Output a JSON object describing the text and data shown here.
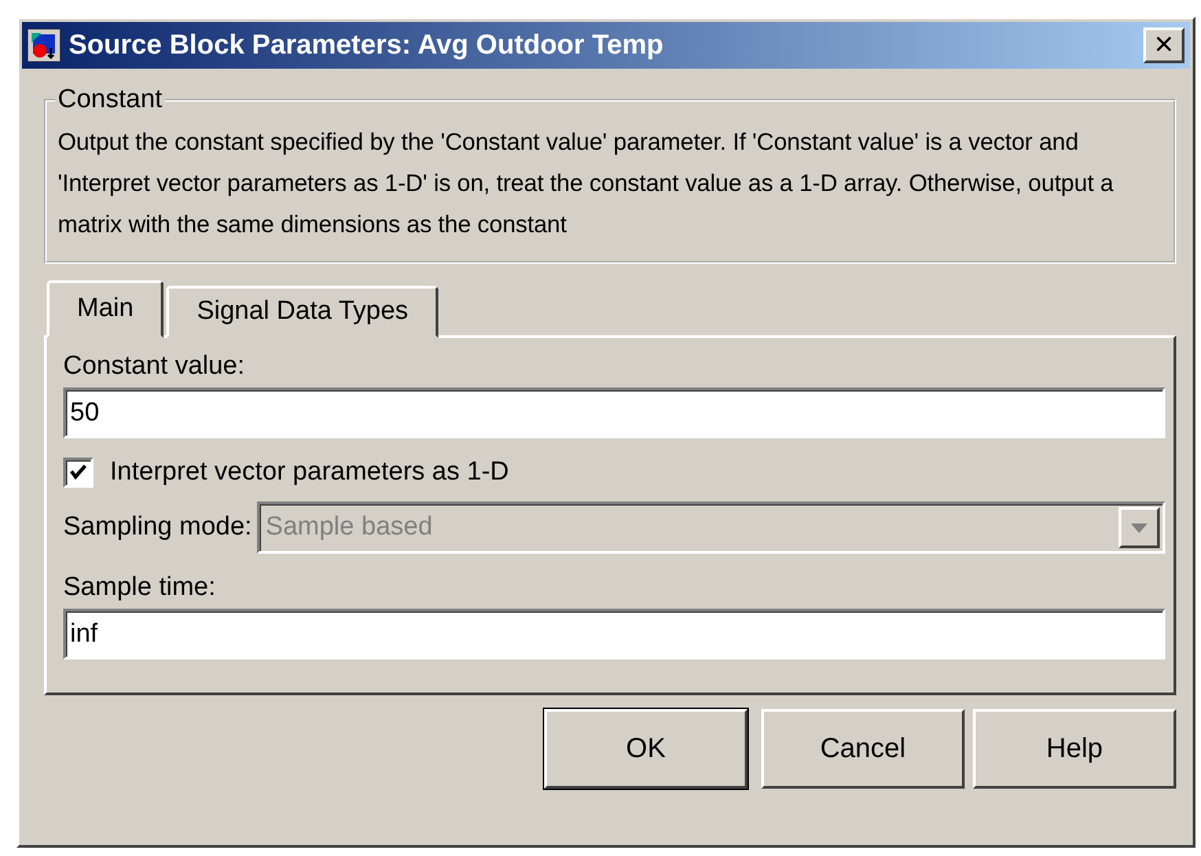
{
  "window": {
    "title": "Source Block Parameters: Avg Outdoor Temp",
    "close": "×"
  },
  "group": {
    "title": "Constant",
    "description": "Output the constant specified by the 'Constant value' parameter. If 'Constant value' is a vector and 'Interpret vector parameters as 1-D' is on, treat the constant value as a 1-D array. Otherwise, output a matrix with the same dimensions as the constant"
  },
  "tabs": [
    {
      "label": "Main",
      "selected": true
    },
    {
      "label": "Signal Data Types",
      "selected": false
    }
  ],
  "params": [
    {
      "kind": "text",
      "label": "Constant value:",
      "value": "50"
    },
    {
      "kind": "checkbox",
      "label": "Interpret vector parameters as 1-D",
      "checked": true
    },
    {
      "kind": "dropdown",
      "label": "Sampling mode:",
      "value": "Sample based",
      "disabled": true
    },
    {
      "kind": "text",
      "label": "Sample time:",
      "value": "inf"
    }
  ],
  "buttons": [
    "OK",
    "Cancel",
    "Help"
  ]
}
